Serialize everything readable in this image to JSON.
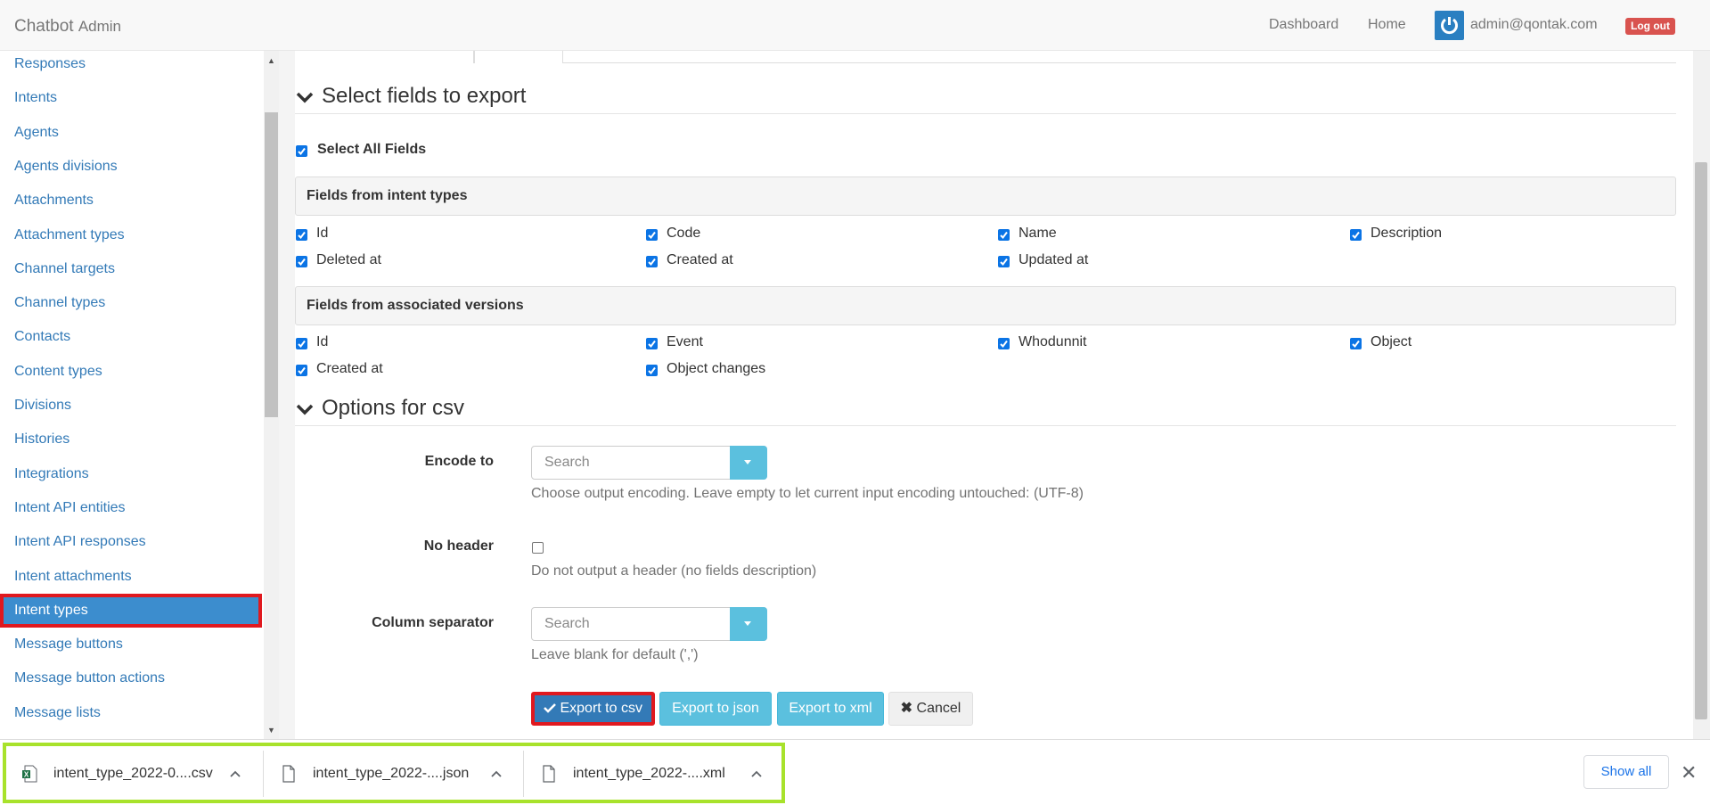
{
  "header": {
    "brand": "Chatbot",
    "brand_sub": "Admin",
    "nav": [
      "Dashboard",
      "Home"
    ],
    "user_email": "admin@qontak.com",
    "logout_label": "Log out"
  },
  "sidebar": {
    "items": [
      {
        "label": "Responses",
        "active": false
      },
      {
        "label": "Intents",
        "active": false
      },
      {
        "label": "Agents",
        "active": false
      },
      {
        "label": "Agents divisions",
        "active": false
      },
      {
        "label": "Attachments",
        "active": false
      },
      {
        "label": "Attachment types",
        "active": false
      },
      {
        "label": "Channel targets",
        "active": false
      },
      {
        "label": "Channel types",
        "active": false
      },
      {
        "label": "Contacts",
        "active": false
      },
      {
        "label": "Content types",
        "active": false
      },
      {
        "label": "Divisions",
        "active": false
      },
      {
        "label": "Histories",
        "active": false
      },
      {
        "label": "Integrations",
        "active": false
      },
      {
        "label": "Intent API entities",
        "active": false
      },
      {
        "label": "Intent API responses",
        "active": false
      },
      {
        "label": "Intent attachments",
        "active": false
      },
      {
        "label": "Intent types",
        "active": true
      },
      {
        "label": "Message buttons",
        "active": false
      },
      {
        "label": "Message button actions",
        "active": false
      },
      {
        "label": "Message lists",
        "active": false
      }
    ]
  },
  "export": {
    "section_fields_title": "Select fields to export",
    "select_all_label": "Select All Fields",
    "group_intent_types": {
      "title": "Fields from intent types",
      "fields": [
        "Id",
        "Code",
        "Name",
        "Description",
        "Deleted at",
        "Created at",
        "Updated at"
      ]
    },
    "group_versions": {
      "title": "Fields from associated versions",
      "fields": [
        "Id",
        "Event",
        "Whodunnit",
        "Object",
        "Created at",
        "Object changes"
      ]
    },
    "section_options_title": "Options for csv",
    "encode_label": "Encode to",
    "encode_placeholder": "Search",
    "encode_help": "Choose output encoding. Leave empty to let current input encoding untouched: (UTF-8)",
    "no_header_label": "No header",
    "no_header_help": "Do not output a header (no fields description)",
    "separator_label": "Column separator",
    "separator_placeholder": "Search",
    "separator_help": "Leave blank for default (',')",
    "buttons": {
      "csv": "Export to csv",
      "json": "Export to json",
      "xml": "Export to xml",
      "cancel": "Cancel"
    }
  },
  "downloads": {
    "items": [
      {
        "name": "intent_type_2022-0....csv",
        "icon": "excel-file-icon"
      },
      {
        "name": "intent_type_2022-....json",
        "icon": "file-icon"
      },
      {
        "name": "intent_type_2022-....xml",
        "icon": "file-icon"
      }
    ],
    "show_all_label": "Show all"
  },
  "colors": {
    "link": "#337ab7",
    "active_item": "#3c8dce",
    "highlight_red": "#e0191f",
    "highlight_green": "#a8e22b",
    "info_button": "#5bc0de"
  }
}
